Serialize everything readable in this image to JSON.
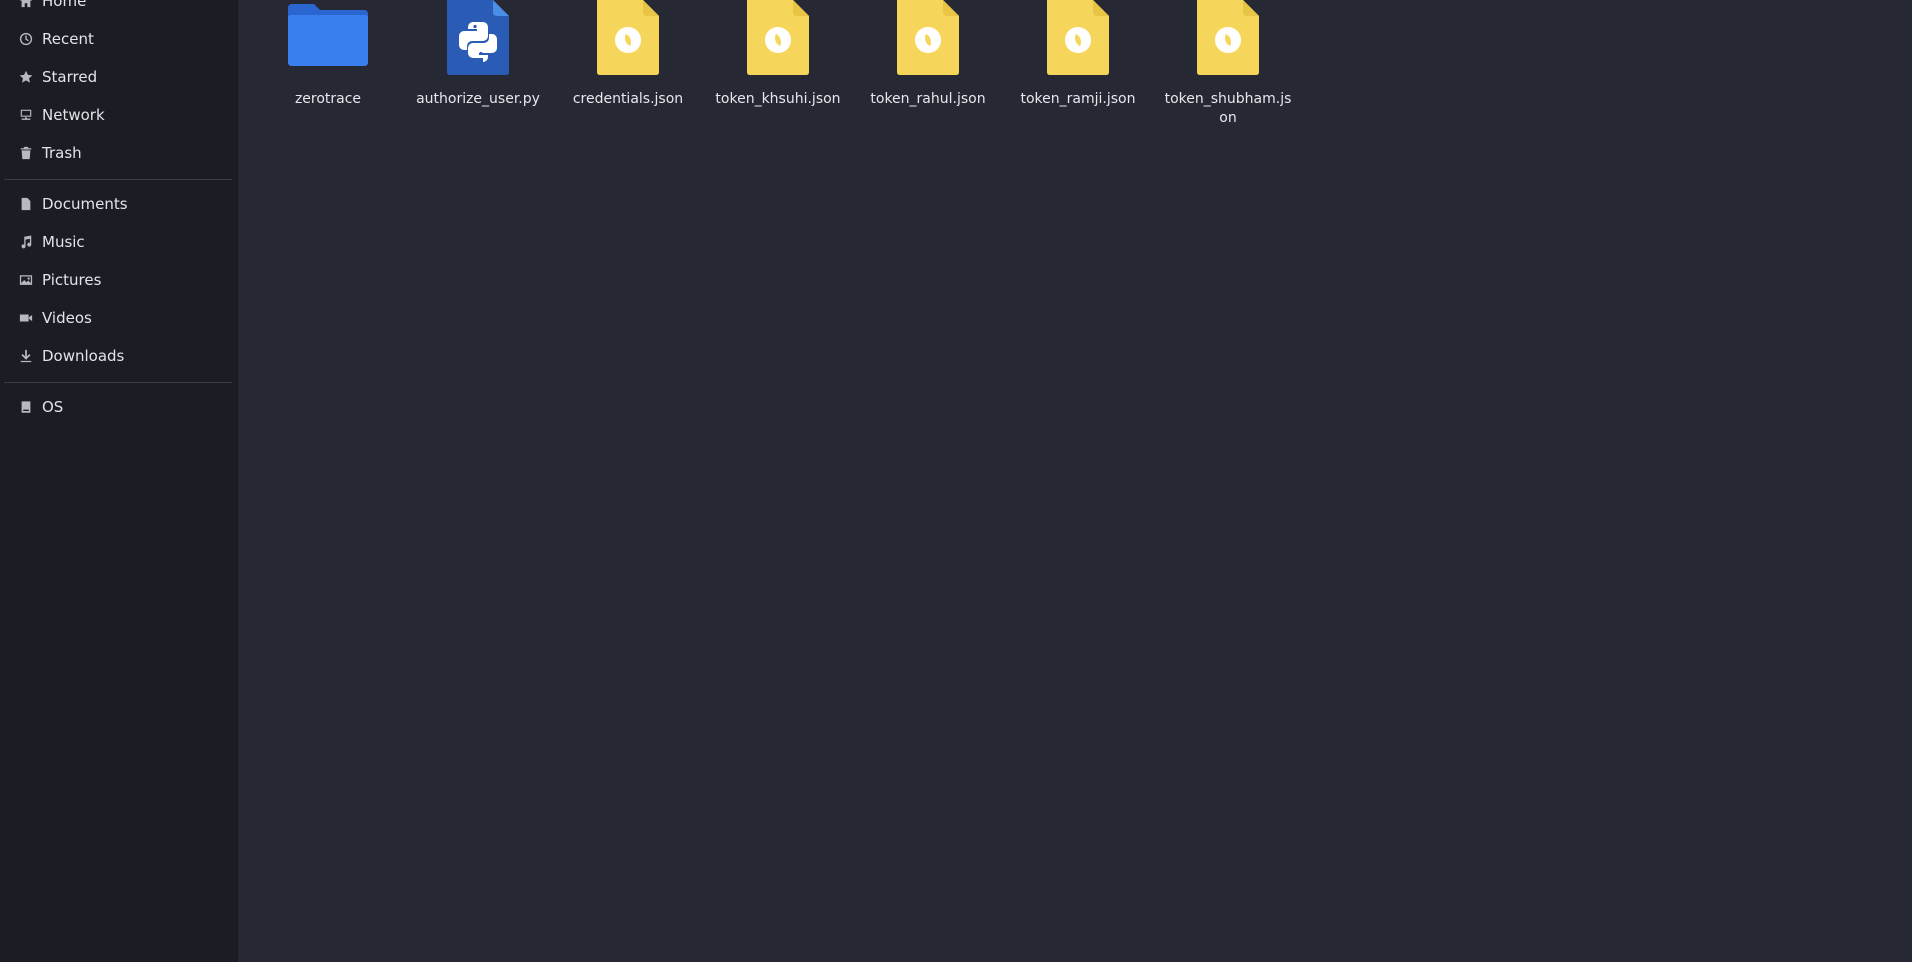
{
  "sidebar": {
    "places": [
      {
        "label": "Home",
        "icon": "home-icon"
      },
      {
        "label": "Recent",
        "icon": "clock-icon"
      },
      {
        "label": "Starred",
        "icon": "star-icon"
      },
      {
        "label": "Network",
        "icon": "network-icon"
      },
      {
        "label": "Trash",
        "icon": "trash-icon"
      }
    ],
    "bookmarks": [
      {
        "label": "Documents",
        "icon": "document-icon"
      },
      {
        "label": "Music",
        "icon": "music-icon"
      },
      {
        "label": "Pictures",
        "icon": "picture-icon"
      },
      {
        "label": "Videos",
        "icon": "video-icon"
      },
      {
        "label": "Downloads",
        "icon": "download-icon"
      }
    ],
    "devices": [
      {
        "label": "OS",
        "icon": "drive-icon"
      }
    ]
  },
  "files": [
    {
      "name": "zerotrace",
      "type": "folder",
      "icon": "folder-icon"
    },
    {
      "name": "authorize_user.py",
      "type": "python",
      "icon": "python-file-icon"
    },
    {
      "name": "credentials.json",
      "type": "json",
      "icon": "json-file-icon"
    },
    {
      "name": "token_khsuhi.json",
      "type": "json",
      "icon": "json-file-icon"
    },
    {
      "name": "token_rahul.json",
      "type": "json",
      "icon": "json-file-icon"
    },
    {
      "name": "token_ramji.json",
      "type": "json",
      "icon": "json-file-icon"
    },
    {
      "name": "token_shubham.json",
      "type": "json",
      "icon": "json-file-icon"
    }
  ],
  "colors": {
    "sidebar_bg": "#1b1d24",
    "main_bg": "#262833",
    "folder_blue": "#3a7ff0",
    "json_yellow": "#f5d65a",
    "python_blue": "#2a5bb5"
  }
}
